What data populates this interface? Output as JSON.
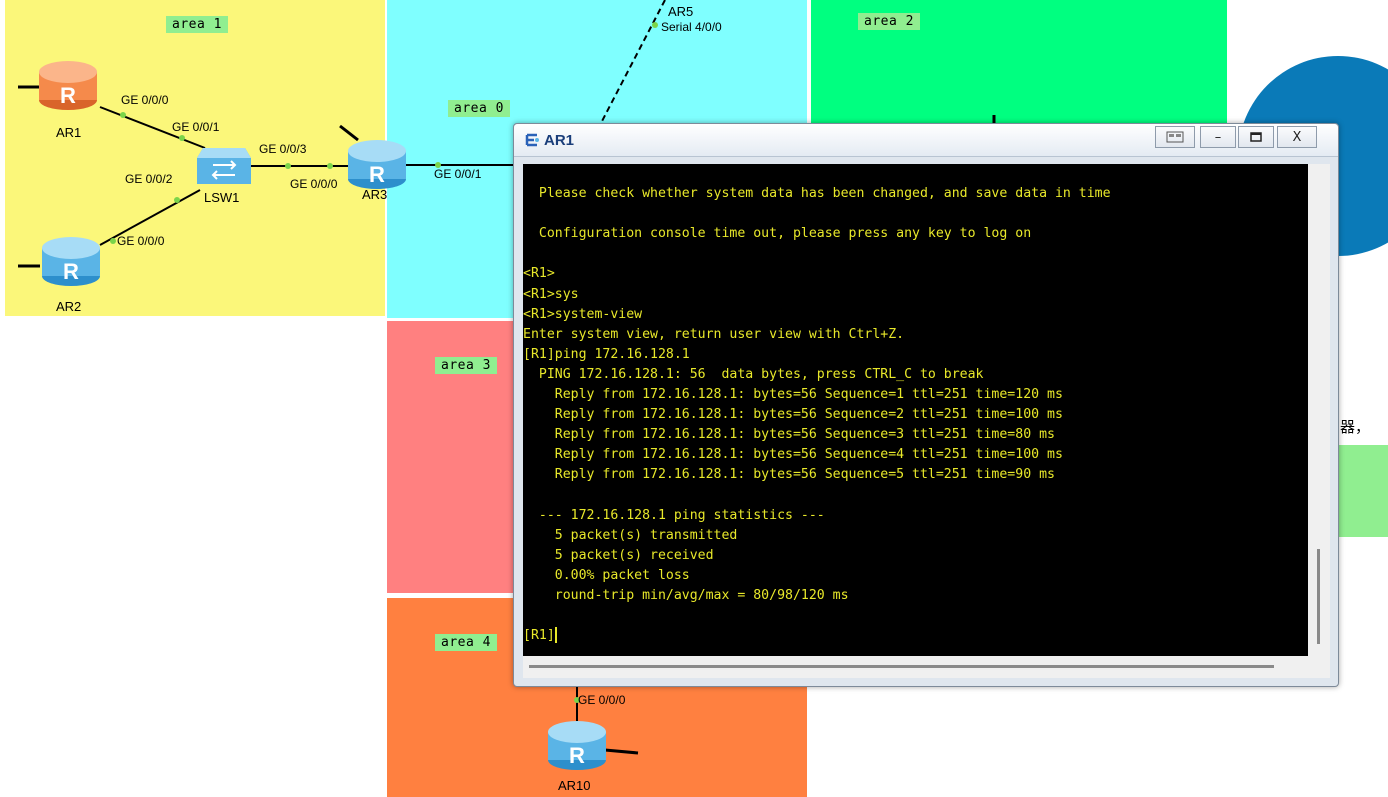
{
  "areas": {
    "area1": "area 1",
    "area0": "area 0",
    "area2": "area 2",
    "area3": "area 3",
    "area4": "area 4"
  },
  "colors": {
    "area1": "#fbf77a",
    "area0": "#7fffff",
    "area2": "#00ff80",
    "area3": "#ff8080",
    "area4": "#ff8040",
    "router_orange": "#f58a4b",
    "router_blue": "#5ab4e6",
    "terminal_text": "#e8e82a"
  },
  "devices": {
    "ar1": "AR1",
    "ar2": "AR2",
    "ar3": "AR3",
    "ar5": "AR5",
    "ar10": "AR10",
    "lsw1": "LSW1"
  },
  "interfaces": {
    "ar1_ge000": "GE 0/0/0",
    "lsw1_ge001": "GE 0/0/1",
    "lsw1_ge002": "GE 0/0/2",
    "lsw1_ge003": "GE 0/0/3",
    "ar2_ge000": "GE 0/0/0",
    "ar3_ge000": "GE 0/0/0",
    "ar3_ge001": "GE 0/0/1",
    "ar5_serial": "Serial 4/0/0",
    "ar10_ge000": "GE 0/0/0"
  },
  "side_glyph": "器，",
  "terminal": {
    "title": "AR1",
    "icon": "terminal-app-icon",
    "lines": [
      "",
      "  Please check whether system data has been changed, and save data in time",
      "",
      "  Configuration console time out, please press any key to log on",
      "",
      "<R1>",
      "<R1>sys",
      "<R1>system-view",
      "Enter system view, return user view with Ctrl+Z.",
      "[R1]ping 172.16.128.1",
      "  PING 172.16.128.1: 56  data bytes, press CTRL_C to break",
      "    Reply from 172.16.128.1: bytes=56 Sequence=1 ttl=251 time=120 ms",
      "    Reply from 172.16.128.1: bytes=56 Sequence=2 ttl=251 time=100 ms",
      "    Reply from 172.16.128.1: bytes=56 Sequence=3 ttl=251 time=80 ms",
      "    Reply from 172.16.128.1: bytes=56 Sequence=4 ttl=251 time=100 ms",
      "    Reply from 172.16.128.1: bytes=56 Sequence=5 ttl=251 time=90 ms",
      "",
      "  --- 172.16.128.1 ping statistics ---",
      "    5 packet(s) transmitted",
      "    5 packet(s) received",
      "    0.00% packet loss",
      "    round-trip min/avg/max = 80/98/120 ms",
      "",
      "[R1]"
    ]
  }
}
